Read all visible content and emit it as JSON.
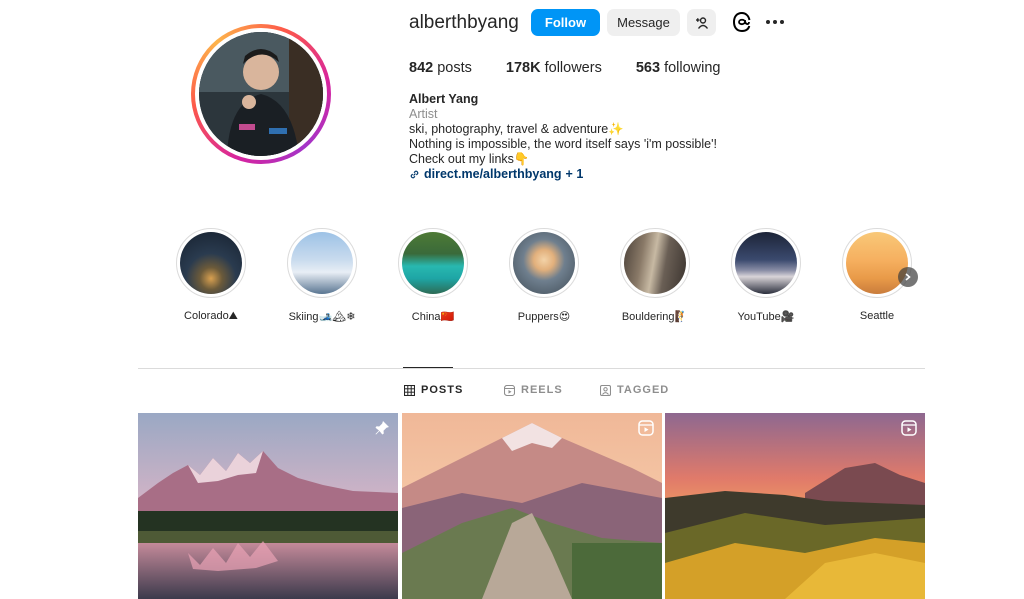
{
  "profile": {
    "username": "alberthbyang",
    "follow_label": "Follow",
    "message_label": "Message",
    "stats": {
      "posts_count": "842",
      "posts_label": "posts",
      "followers_count": "178K",
      "followers_label": "followers",
      "following_count": "563",
      "following_label": "following"
    },
    "bio": {
      "name": "Albert Yang",
      "category": "Artist",
      "line1": "ski, photography, travel & adventure✨",
      "line2": "Nothing is impossible, the word itself says 'i'm possible'!",
      "line3": "Check out my links👇",
      "link": "direct.me/alberthbyang",
      "link_extra": "+ 1"
    }
  },
  "highlights": [
    {
      "label": "Colorado⛰"
    },
    {
      "label": "Skiing🎿🏔❄"
    },
    {
      "label": "China🇨🇳"
    },
    {
      "label": "Puppers😍"
    },
    {
      "label": "Bouldering🧗"
    },
    {
      "label": "YouTube🎥"
    },
    {
      "label": "Seattle"
    }
  ],
  "tabs": {
    "posts": "POSTS",
    "reels": "REELS",
    "tagged": "TAGGED"
  },
  "colors": {
    "accent": "#0095f6",
    "link": "#00376b",
    "muted": "#8e8e8e"
  }
}
